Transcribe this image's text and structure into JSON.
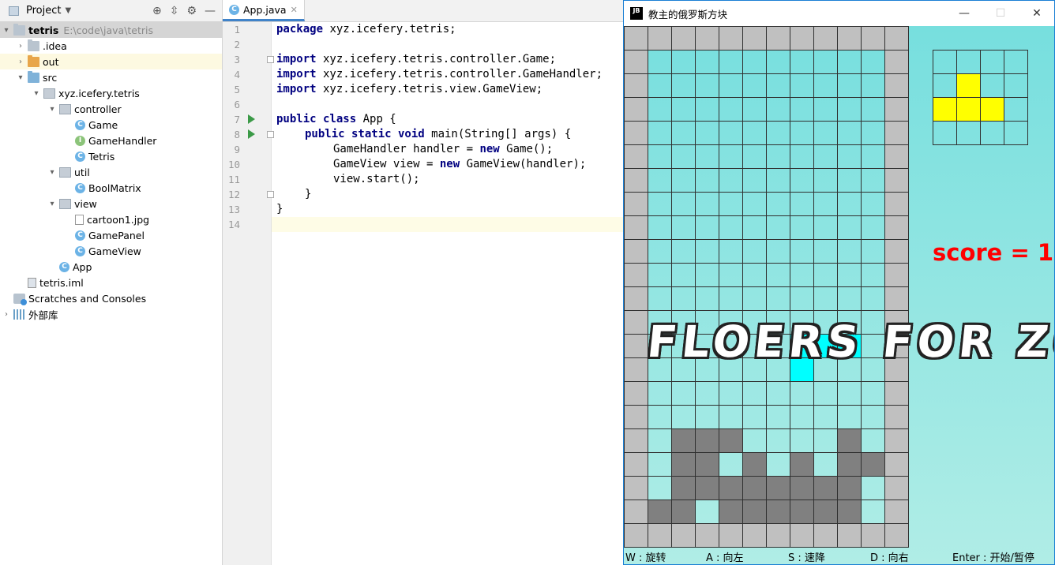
{
  "project_panel": {
    "title": "Project",
    "tree": [
      {
        "label": "tetris",
        "path": "E:\\code\\java\\tetris",
        "icon": "module-folder-icon",
        "bold": true,
        "selected": true
      },
      {
        "label": ".idea",
        "icon": "folder-icon"
      },
      {
        "label": "out",
        "icon": "folder-orange-icon",
        "highlighted": true
      },
      {
        "label": "src",
        "icon": "source-folder-icon"
      },
      {
        "label": "xyz.icefery.tetris",
        "icon": "package-icon"
      },
      {
        "label": "controller",
        "icon": "package-icon"
      },
      {
        "label": "Game",
        "icon": "class-icon"
      },
      {
        "label": "GameHandler",
        "icon": "interface-icon"
      },
      {
        "label": "Tetris",
        "icon": "class-icon"
      },
      {
        "label": "util",
        "icon": "package-icon"
      },
      {
        "label": "BoolMatrix",
        "icon": "class-icon"
      },
      {
        "label": "view",
        "icon": "package-icon"
      },
      {
        "label": "cartoon1.jpg",
        "icon": "image-file-icon"
      },
      {
        "label": "GamePanel",
        "icon": "class-icon"
      },
      {
        "label": "GameView",
        "icon": "class-icon"
      },
      {
        "label": "App",
        "icon": "runnable-class-icon"
      },
      {
        "label": "tetris.iml",
        "icon": "iml-file-icon"
      },
      {
        "label": "Scratches and Consoles",
        "icon": "scratches-icon"
      },
      {
        "label": "外部库",
        "icon": "libraries-icon"
      }
    ]
  },
  "editor": {
    "tab_label": "App.java",
    "line_numbers": [
      "1",
      "2",
      "3",
      "4",
      "5",
      "6",
      "7",
      "8",
      "9",
      "10",
      "11",
      "12",
      "13",
      "14"
    ],
    "code": {
      "l1_kw": "package",
      "l1_rest": " xyz.icefery.tetris;",
      "l3_kw": "import",
      "l3_rest": " xyz.icefery.tetris.controller.Game;",
      "l4_kw": "import",
      "l4_rest": " xyz.icefery.tetris.controller.GameHandler;",
      "l5_kw": "import",
      "l5_rest": " xyz.icefery.tetris.view.GameView;",
      "l7_kw": "public class",
      "l7_rest": " App {",
      "l8_kw": "public static void",
      "l8_rest": " main(String[] args) {",
      "l9_a": "GameHandler handler = ",
      "l9_kw": "new",
      "l9_b": " Game();",
      "l10_a": "GameView view = ",
      "l10_kw": "new",
      "l10_b": " GameView(handler);",
      "l11": "view.start();",
      "l12": "}",
      "l13": "}"
    }
  },
  "game_window": {
    "title": "教主的俄罗斯方块",
    "app_badge": "JB",
    "score_text": "score = 1",
    "score_value": 1,
    "banner_text": "FLOERS FOR ZOE!",
    "controls": [
      "W : 旋转",
      "A : 向左",
      "S : 速降",
      "D : 向右",
      "Enter : 开始/暂停"
    ],
    "colors": {
      "wall": "#c0c0c0",
      "stacked": "#808080",
      "falling": "#00ffff",
      "preview": "#ffff00",
      "empty": "transparent"
    },
    "board_rows": [
      "WWWWWWWWWWWW",
      "W..........W",
      "W..........W",
      "W..........W",
      "W..........W",
      "W..........W",
      "W..........W",
      "W..........W",
      "W..........W",
      "W..........W",
      "W..........W",
      "W..........W",
      "W..........W",
      "W......CCC.W",
      "W......C...W",
      "W..........W",
      "W..........W",
      "W.XXX....X.W",
      "W.XX.X.X.XXW",
      "W.XXXXXXXX.W",
      "WXX.XXXXXX.W",
      "WWWWWWWWWWWW"
    ],
    "next_piece_rows": [
      "....",
      ".Y..",
      "YYY.",
      "...."
    ]
  }
}
